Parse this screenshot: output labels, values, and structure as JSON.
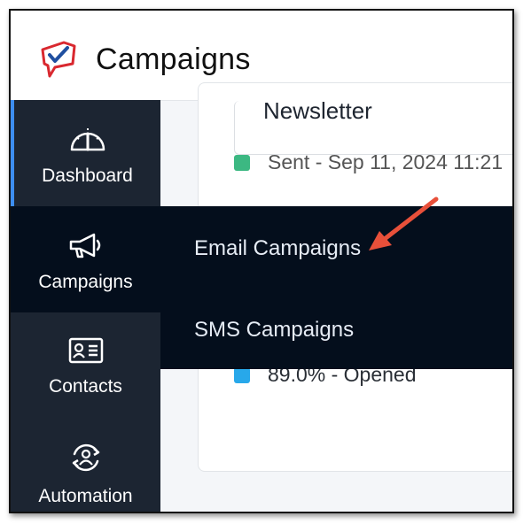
{
  "header": {
    "title": "Campaigns",
    "logo_icon": "megaphone-check-logo-icon"
  },
  "sidebar": {
    "items": [
      {
        "label": "Dashboard",
        "icon": "speedometer-icon"
      },
      {
        "label": "Campaigns",
        "icon": "megaphone-icon"
      },
      {
        "label": "Contacts",
        "icon": "contact-card-icon"
      },
      {
        "label": "Automation",
        "icon": "automation-cycle-icon"
      }
    ]
  },
  "flyout": {
    "items": [
      {
        "label": "Email Campaigns"
      },
      {
        "label": "SMS Campaigns"
      }
    ]
  },
  "campaign_card": {
    "name": "Newsletter",
    "status": "Sent - Sep 11, 2024 11:21",
    "opened": "89.0% - Opened"
  },
  "colors": {
    "accent": "#3d8ef0",
    "sidebar_bg": "#1c2532",
    "flyout_bg": "#040e1c",
    "sent_dot": "#3cb882",
    "opened_dot": "#28a8ea",
    "annotation_arrow": "#e8503a"
  }
}
